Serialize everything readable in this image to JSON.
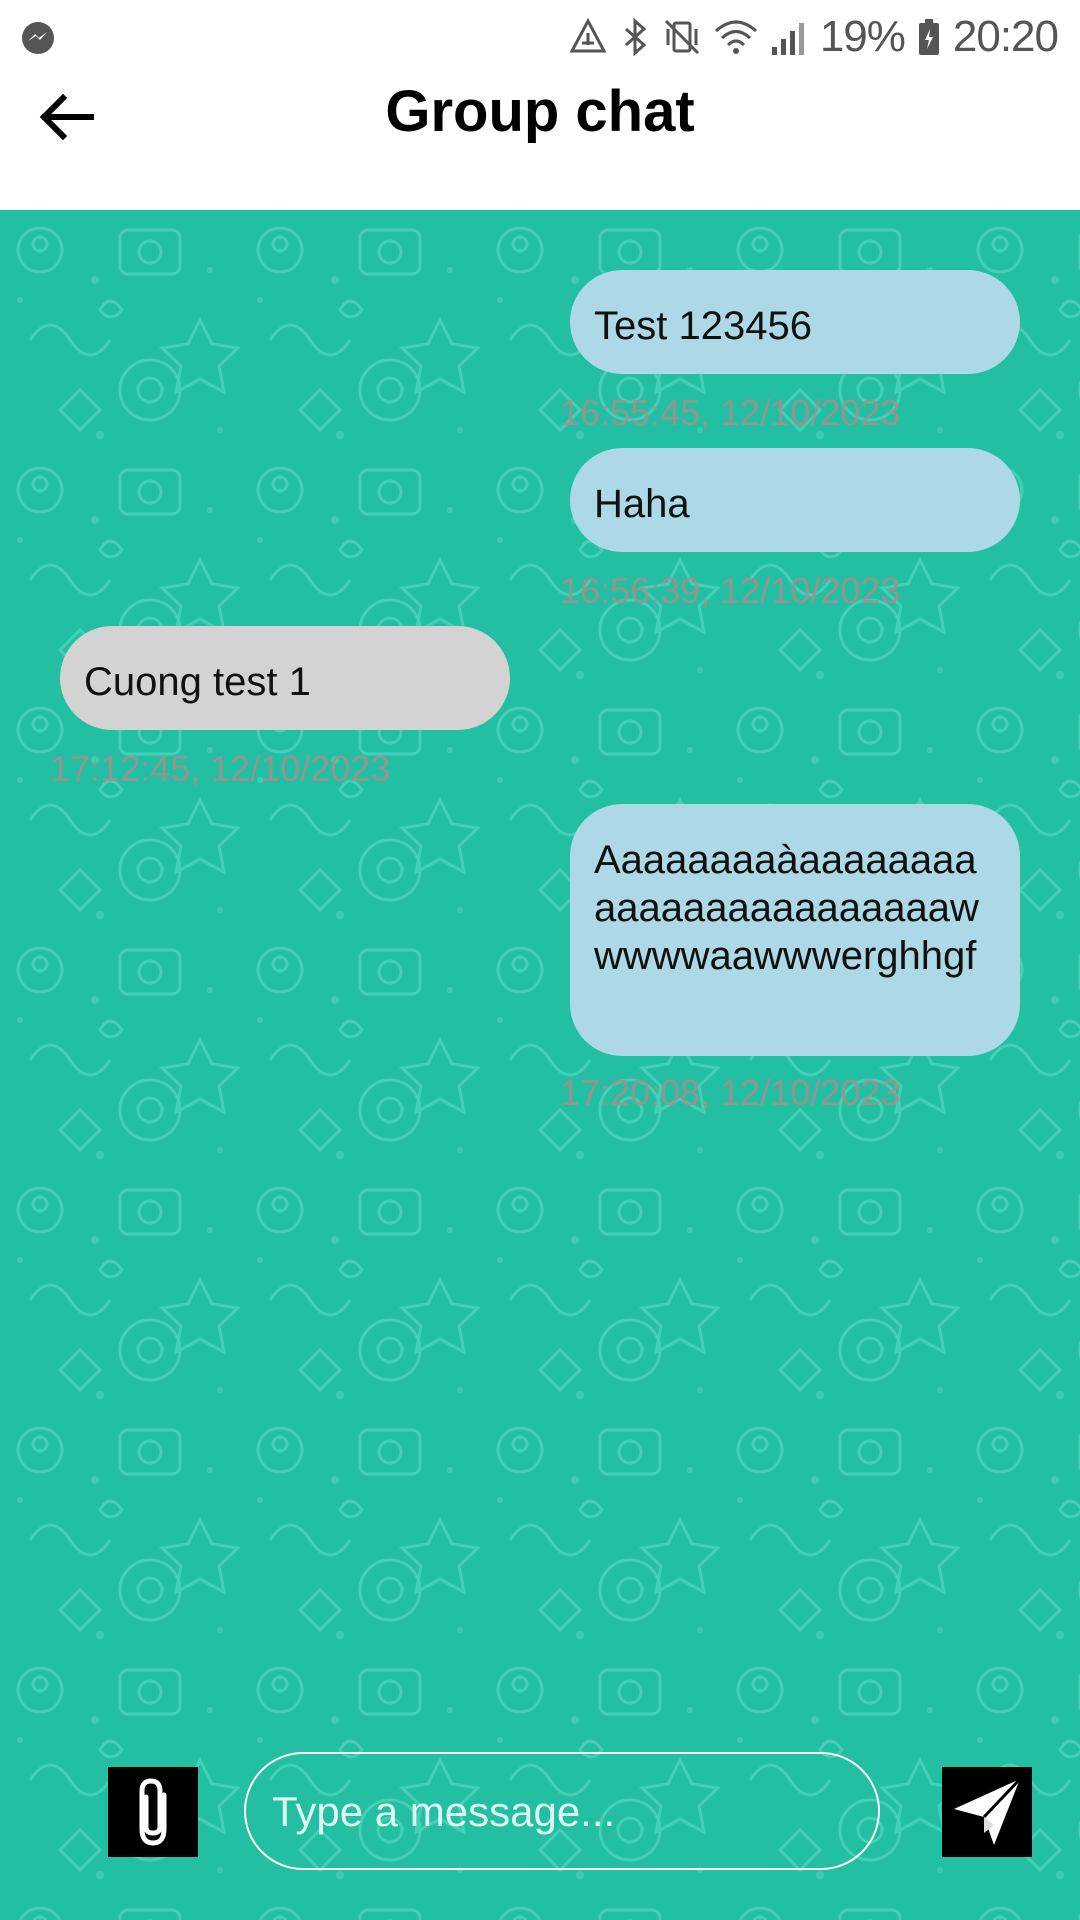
{
  "status_bar": {
    "battery": "19%",
    "time": "20:20",
    "icons": [
      "messenger-icon",
      "data-saver-icon",
      "bluetooth-icon",
      "vibrate-icon",
      "wifi-icon",
      "signal-icon",
      "battery-charging-icon"
    ]
  },
  "header": {
    "title": "Group chat",
    "back_icon": "arrow-left-icon"
  },
  "messages": [
    {
      "sender": "me",
      "text": "Test 123456",
      "time": "16:55:45, 12/10/2023"
    },
    {
      "sender": "me",
      "text": "Haha",
      "time": "16:56:39, 12/10/2023"
    },
    {
      "sender": "other",
      "text": "Cuong test 1",
      "time": "17:12:45, 12/10/2023"
    },
    {
      "sender": "me",
      "text": "Aaaaaaaaàaaaaaaaaaaaaaaaaaaaaaaaawwwwwaawwwerghhgf",
      "time": "17:20:08, 12/10/2023"
    }
  ],
  "composer": {
    "placeholder": "Type a message...",
    "value": "",
    "attach_icon": "paperclip-icon",
    "send_icon": "paper-plane-icon"
  },
  "colors": {
    "chat_background": "#22bfa2",
    "my_bubble": "#add8e6",
    "other_bubble": "#d3d3d3",
    "timestamp": "#aa8c8c"
  }
}
